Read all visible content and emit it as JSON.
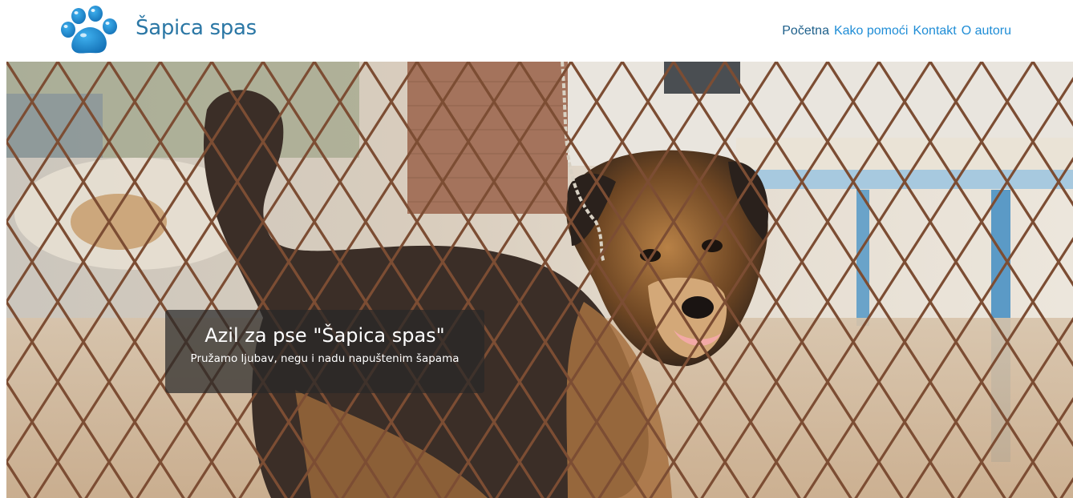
{
  "header": {
    "logo_icon": "paw-icon",
    "title": "Šapica spas"
  },
  "nav": {
    "items": [
      {
        "label": "Početna",
        "active": true
      },
      {
        "label": "Kako pomoći",
        "active": false
      },
      {
        "label": "Kontakt",
        "active": false
      },
      {
        "label": "O autoru",
        "active": false
      }
    ]
  },
  "hero": {
    "image_subject": "dog-behind-fence-photo",
    "caption": {
      "title": "Azil za pse \"Šapica spas\"",
      "subtitle": "Pružamo ljubav, negu i nadu napuštenim šapama"
    }
  },
  "colors": {
    "brand": "#2b77a5",
    "nav_link": "#1f8dd6",
    "nav_active": "#1d5f8a",
    "caption_bg": "rgba(40,40,40,0.72)"
  }
}
